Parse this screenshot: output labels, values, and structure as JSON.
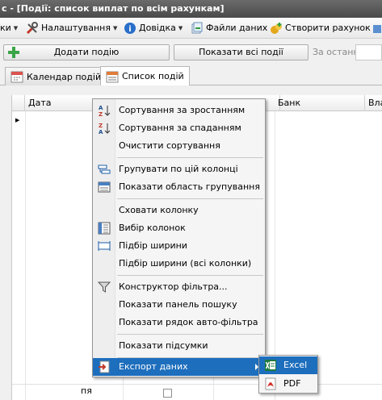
{
  "window": {
    "title": "с - [Події: список виплат по всім рахункам]"
  },
  "menubar": {
    "items": [
      {
        "label": "ки",
        "icon": "reports-icon"
      },
      {
        "label": "Налаштування",
        "icon": "tools-icon"
      },
      {
        "label": "Довідка",
        "icon": "help-icon"
      },
      {
        "label": "Файли даних",
        "icon": "data-files-icon"
      },
      {
        "label": "Створити рахунок",
        "icon": "create-account-icon"
      }
    ]
  },
  "toolbar": {
    "add_event": "Додати подію",
    "show_all": "Показати всі події",
    "since_label": "За останні:"
  },
  "tabs": [
    {
      "label": "Календар подій",
      "active": false
    },
    {
      "label": "Список подій",
      "active": true
    }
  ],
  "grid": {
    "columns": [
      "Дата",
      "Банк",
      "Вла"
    ],
    "bottom_row_text": "пя"
  },
  "context_menu": {
    "items": [
      {
        "label": "Сортування за зростанням",
        "icon": "sort-ascending-icon"
      },
      {
        "label": "Сортування за спаданням",
        "icon": "sort-descending-icon"
      },
      {
        "label": "Очистити сортування",
        "icon": ""
      },
      {
        "label": "Групувати по цій колонці",
        "icon": "group-by-column-icon"
      },
      {
        "label": "Показати область групування",
        "icon": "group-panel-icon"
      },
      {
        "label": "Сховати колонку",
        "icon": ""
      },
      {
        "label": "Вибір колонок",
        "icon": "column-chooser-icon"
      },
      {
        "label": "Підбір ширини",
        "icon": "best-fit-icon"
      },
      {
        "label": "Підбір ширини (всі колонки)",
        "icon": ""
      },
      {
        "label": "Конструктор фільтра...",
        "icon": "filter-icon"
      },
      {
        "label": "Показати панель пошуку",
        "icon": ""
      },
      {
        "label": "Показати рядок авто-фільтра",
        "icon": ""
      },
      {
        "label": "Показати підсумки",
        "icon": ""
      },
      {
        "label": "Експорт даних",
        "icon": "export-icon",
        "highlighted": true
      }
    ]
  },
  "export_submenu": {
    "items": [
      {
        "label": "Excel",
        "icon": "excel-icon",
        "highlighted": true
      },
      {
        "label": "PDF",
        "icon": "pdf-icon"
      }
    ]
  },
  "colors": {
    "highlight": "#1d6ebd",
    "titlebar": "#555555"
  }
}
